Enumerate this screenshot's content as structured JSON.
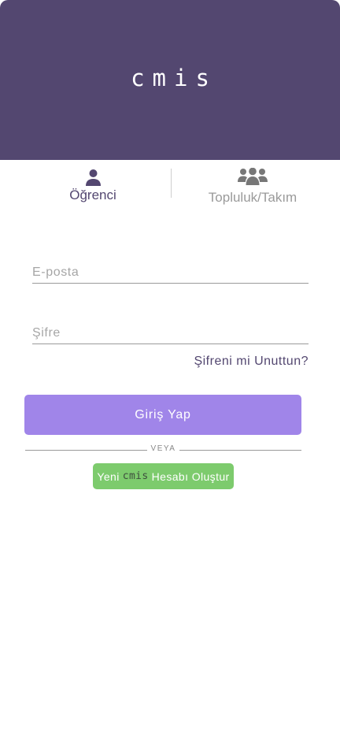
{
  "header": {
    "logo_text": "cmis"
  },
  "tabs": [
    {
      "label": "Öğrenci",
      "icon": "user-icon",
      "active": true
    },
    {
      "label": "Topluluk/Takım",
      "icon": "users-group-icon",
      "active": false
    }
  ],
  "form": {
    "email_placeholder": "E-posta",
    "email_value": "",
    "password_placeholder": "Şifre",
    "password_value": "",
    "forgot_label": "Şifreni mi Unuttun?",
    "login_label": "Giriş Yap",
    "or_label": "VEYA",
    "signup_prefix": "Yeni",
    "signup_brand": "cmis",
    "signup_suffix": "Hesabı Oluştur"
  },
  "colors": {
    "header_bg": "#534770",
    "active_tab": "#534770",
    "inactive_tab": "#9a9a9a",
    "login_button": "#a085e9",
    "signup_button": "#7dcb6d"
  }
}
